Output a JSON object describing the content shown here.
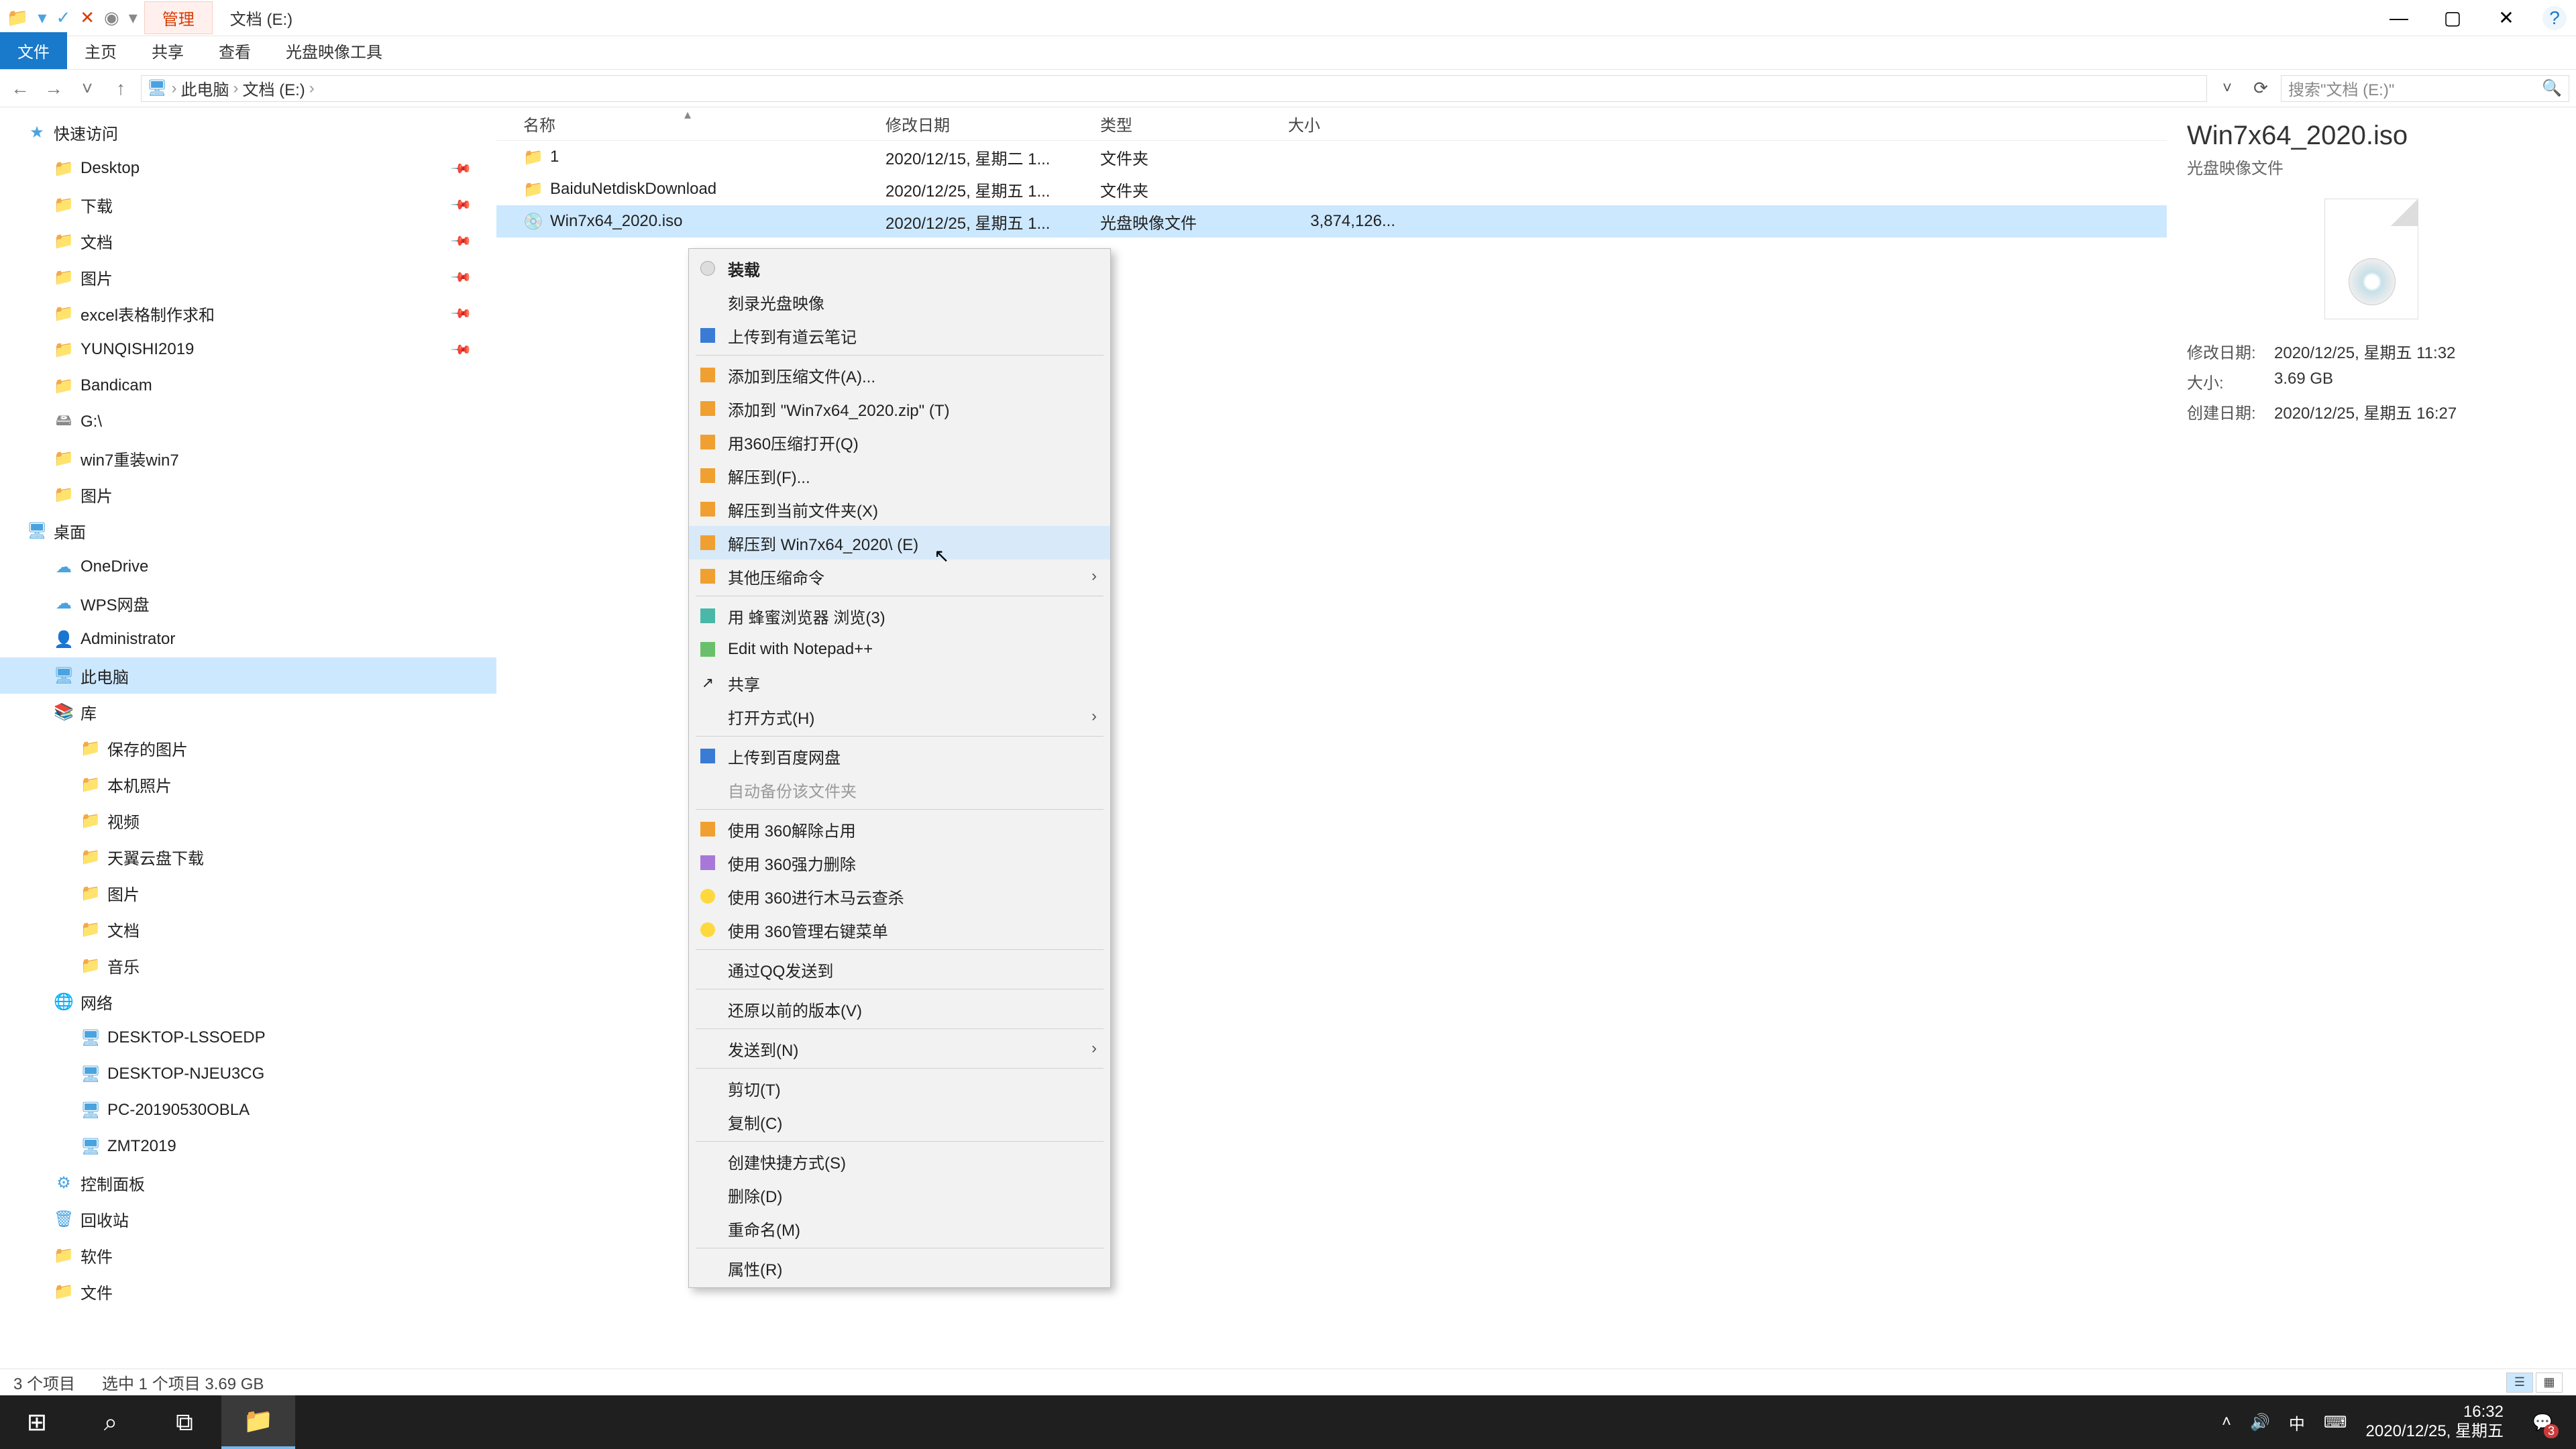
{
  "titlebar": {
    "manage": "管理",
    "title": "文档 (E:)"
  },
  "winctrl": {
    "min": "—",
    "max": "▢",
    "close": "✕",
    "help": "?"
  },
  "ribbon": {
    "file": "文件",
    "home": "主页",
    "share": "共享",
    "view": "查看",
    "disc": "光盘映像工具"
  },
  "addr": {
    "back": "←",
    "fwd": "→",
    "up": "↑",
    "pc": "此电脑",
    "loc": "文档 (E:)",
    "sep": "›",
    "drop": "˅",
    "refresh": "⟳",
    "search_ph": "搜索\"文档 (E:)\"",
    "mag": "🔍"
  },
  "tree": [
    {
      "d": 1,
      "ico": "★",
      "cls": "star",
      "t": "快速访问"
    },
    {
      "d": 2,
      "ico": "📁",
      "cls": "fold-b",
      "t": "Desktop",
      "pin": true
    },
    {
      "d": 2,
      "ico": "📁",
      "cls": "fold-b",
      "t": "下载",
      "pin": true
    },
    {
      "d": 2,
      "ico": "📁",
      "cls": "fold-b",
      "t": "文档",
      "pin": true
    },
    {
      "d": 2,
      "ico": "📁",
      "cls": "fold-b",
      "t": "图片",
      "pin": true
    },
    {
      "d": 2,
      "ico": "📁",
      "cls": "fold-y",
      "t": "excel表格制作求和",
      "pin": true
    },
    {
      "d": 2,
      "ico": "📁",
      "cls": "fold-y",
      "t": "YUNQISHI2019",
      "pin": true
    },
    {
      "d": 2,
      "ico": "📁",
      "cls": "fold-y",
      "t": "Bandicam"
    },
    {
      "d": 2,
      "ico": "🖴",
      "cls": "disk",
      "t": "G:\\"
    },
    {
      "d": 2,
      "ico": "📁",
      "cls": "fold-y",
      "t": "win7重装win7"
    },
    {
      "d": 2,
      "ico": "📁",
      "cls": "fold-y",
      "t": "图片"
    },
    {
      "d": 1,
      "ico": "🖥",
      "cls": "monitor",
      "t": "桌面"
    },
    {
      "d": 2,
      "ico": "☁",
      "cls": "fold-b",
      "t": "OneDrive"
    },
    {
      "d": 2,
      "ico": "☁",
      "cls": "fold-b",
      "t": "WPS网盘"
    },
    {
      "d": 2,
      "ico": "👤",
      "cls": "fold-b",
      "t": "Administrator"
    },
    {
      "d": 2,
      "ico": "🖥",
      "cls": "monitor",
      "t": "此电脑",
      "sel": true
    },
    {
      "d": 2,
      "ico": "📚",
      "cls": "lib",
      "t": "库"
    },
    {
      "d": 3,
      "ico": "📁",
      "cls": "fold-b",
      "t": "保存的图片"
    },
    {
      "d": 3,
      "ico": "📁",
      "cls": "fold-b",
      "t": "本机照片"
    },
    {
      "d": 3,
      "ico": "📁",
      "cls": "fold-b",
      "t": "视频"
    },
    {
      "d": 3,
      "ico": "📁",
      "cls": "fold-b",
      "t": "天翼云盘下载"
    },
    {
      "d": 3,
      "ico": "📁",
      "cls": "fold-b",
      "t": "图片"
    },
    {
      "d": 3,
      "ico": "📁",
      "cls": "fold-b",
      "t": "文档"
    },
    {
      "d": 3,
      "ico": "📁",
      "cls": "fold-b",
      "t": "音乐"
    },
    {
      "d": 2,
      "ico": "🌐",
      "cls": "fold-b",
      "t": "网络"
    },
    {
      "d": 3,
      "ico": "🖥",
      "cls": "monitor",
      "t": "DESKTOP-LSSOEDP"
    },
    {
      "d": 3,
      "ico": "🖥",
      "cls": "monitor",
      "t": "DESKTOP-NJEU3CG"
    },
    {
      "d": 3,
      "ico": "🖥",
      "cls": "monitor",
      "t": "PC-20190530OBLA"
    },
    {
      "d": 3,
      "ico": "🖥",
      "cls": "monitor",
      "t": "ZMT2019"
    },
    {
      "d": 2,
      "ico": "⚙",
      "cls": "monitor",
      "t": "控制面板"
    },
    {
      "d": 2,
      "ico": "🗑",
      "cls": "fold-b",
      "t": "回收站"
    },
    {
      "d": 2,
      "ico": "📁",
      "cls": "fold-y",
      "t": "软件"
    },
    {
      "d": 2,
      "ico": "📁",
      "cls": "fold-y",
      "t": "文件"
    }
  ],
  "cols": {
    "name": "名称",
    "date": "修改日期",
    "type": "类型",
    "size": "大小"
  },
  "rows": [
    {
      "ico": "📁",
      "cls": "fold-y",
      "name": "1",
      "date": "2020/12/15, 星期二 1...",
      "type": "文件夹",
      "size": ""
    },
    {
      "ico": "📁",
      "cls": "fold-y",
      "name": "BaiduNetdiskDownload",
      "date": "2020/12/25, 星期五 1...",
      "type": "文件夹",
      "size": ""
    },
    {
      "ico": "💿",
      "cls": "disk",
      "name": "Win7x64_2020.iso",
      "date": "2020/12/25, 星期五 1...",
      "type": "光盘映像文件",
      "size": "3,874,126...",
      "sel": true
    }
  ],
  "ctx": [
    {
      "ico": "sq-disc",
      "t": "装载",
      "bold": true
    },
    {
      "t": "刻录光盘映像"
    },
    {
      "ico": "sq-blue",
      "t": "上传到有道云笔记"
    },
    {
      "sep": true
    },
    {
      "ico": "sq-orange",
      "t": "添加到压缩文件(A)..."
    },
    {
      "ico": "sq-orange",
      "t": "添加到 \"Win7x64_2020.zip\" (T)"
    },
    {
      "ico": "sq-orange",
      "t": "用360压缩打开(Q)"
    },
    {
      "ico": "sq-orange",
      "t": "解压到(F)..."
    },
    {
      "ico": "sq-orange",
      "t": "解压到当前文件夹(X)"
    },
    {
      "ico": "sq-orange",
      "t": "解压到 Win7x64_2020\\ (E)",
      "hover": true
    },
    {
      "ico": "sq-orange",
      "t": "其他压缩命令",
      "arrow": true
    },
    {
      "sep": true
    },
    {
      "ico": "sq-teal",
      "t": "用 蜂蜜浏览器 浏览(3)"
    },
    {
      "ico": "sq-green",
      "t": "Edit with Notepad++"
    },
    {
      "ico": "sq-share",
      "glyph": "↗",
      "t": "共享"
    },
    {
      "t": "打开方式(H)",
      "arrow": true
    },
    {
      "sep": true
    },
    {
      "ico": "sq-blue",
      "t": "上传到百度网盘"
    },
    {
      "t": "自动备份该文件夹",
      "disabled": true
    },
    {
      "sep": true
    },
    {
      "ico": "sq-orange",
      "t": "使用 360解除占用"
    },
    {
      "ico": "sq-purple",
      "t": "使用 360强力删除"
    },
    {
      "ico": "sq-yellow",
      "t": "使用 360进行木马云查杀"
    },
    {
      "ico": "sq-yellow",
      "t": "使用 360管理右键菜单"
    },
    {
      "sep": true
    },
    {
      "t": "通过QQ发送到"
    },
    {
      "sep": true
    },
    {
      "t": "还原以前的版本(V)"
    },
    {
      "sep": true
    },
    {
      "t": "发送到(N)",
      "arrow": true
    },
    {
      "sep": true
    },
    {
      "t": "剪切(T)"
    },
    {
      "t": "复制(C)"
    },
    {
      "sep": true
    },
    {
      "t": "创建快捷方式(S)"
    },
    {
      "t": "删除(D)"
    },
    {
      "t": "重命名(M)"
    },
    {
      "sep": true
    },
    {
      "t": "属性(R)"
    }
  ],
  "preview": {
    "title": "Win7x64_2020.iso",
    "sub": "光盘映像文件",
    "rows": [
      {
        "l": "修改日期:",
        "v": "2020/12/25, 星期五 11:32"
      },
      {
        "l": "大小:",
        "v": "3.69 GB"
      },
      {
        "l": "创建日期:",
        "v": "2020/12/25, 星期五 16:27"
      }
    ]
  },
  "status": {
    "count": "3 个项目",
    "sel": "选中 1 个项目  3.69 GB"
  },
  "taskbar": {
    "ime": "中",
    "time": "16:32",
    "date": "2020/12/25, 星期五",
    "notif": "3"
  }
}
